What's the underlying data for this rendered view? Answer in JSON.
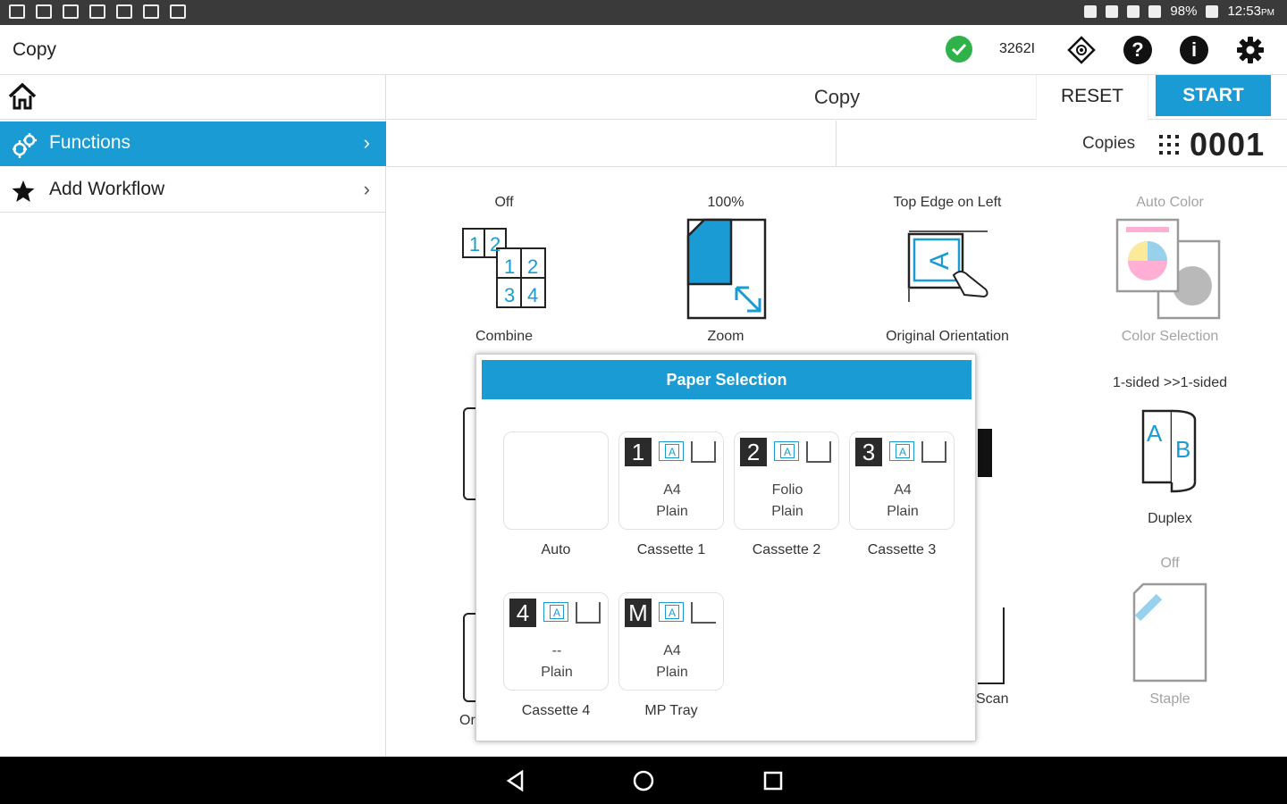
{
  "status_bar": {
    "battery": "98%",
    "time": "12:53",
    "ampm": "PM"
  },
  "app_bar": {
    "title": "Copy",
    "device_id": "3262I"
  },
  "sidebar": {
    "items": [
      {
        "label": "Functions",
        "selected": true
      },
      {
        "label": "Add Workflow",
        "selected": false
      }
    ]
  },
  "main": {
    "title": "Copy",
    "reset_label": "RESET",
    "start_label": "START",
    "copies_label": "Copies",
    "copies_value": "0001"
  },
  "functions": [
    {
      "name": "Combine",
      "value": "Off"
    },
    {
      "name": "Zoom",
      "value": "100%"
    },
    {
      "name": "Original Orientation",
      "value": "Top Edge on Left"
    },
    {
      "name": "Color Selection",
      "value": "Auto Color"
    },
    {
      "name": "Duplex",
      "value": "1-sided >>1-sided"
    },
    {
      "name": "Staple",
      "value": "Off"
    },
    {
      "name": "Scan",
      "value": ""
    },
    {
      "name": "Or",
      "value": ""
    }
  ],
  "dialog": {
    "title": "Paper Selection",
    "options": [
      {
        "label": "Auto",
        "num": "",
        "size": "",
        "type": ""
      },
      {
        "label": "Cassette 1",
        "num": "1",
        "size": "A4",
        "type": "Plain"
      },
      {
        "label": "Cassette 2",
        "num": "2",
        "size": "Folio",
        "type": "Plain"
      },
      {
        "label": "Cassette 3",
        "num": "3",
        "size": "A4",
        "type": "Plain"
      },
      {
        "label": "Cassette 4",
        "num": "4",
        "size": "--",
        "type": "Plain"
      },
      {
        "label": "MP Tray",
        "num": "M",
        "size": "A4",
        "type": "Plain"
      }
    ]
  },
  "colors": {
    "accent": "#1a9bd3",
    "ok": "#2fb24a"
  }
}
